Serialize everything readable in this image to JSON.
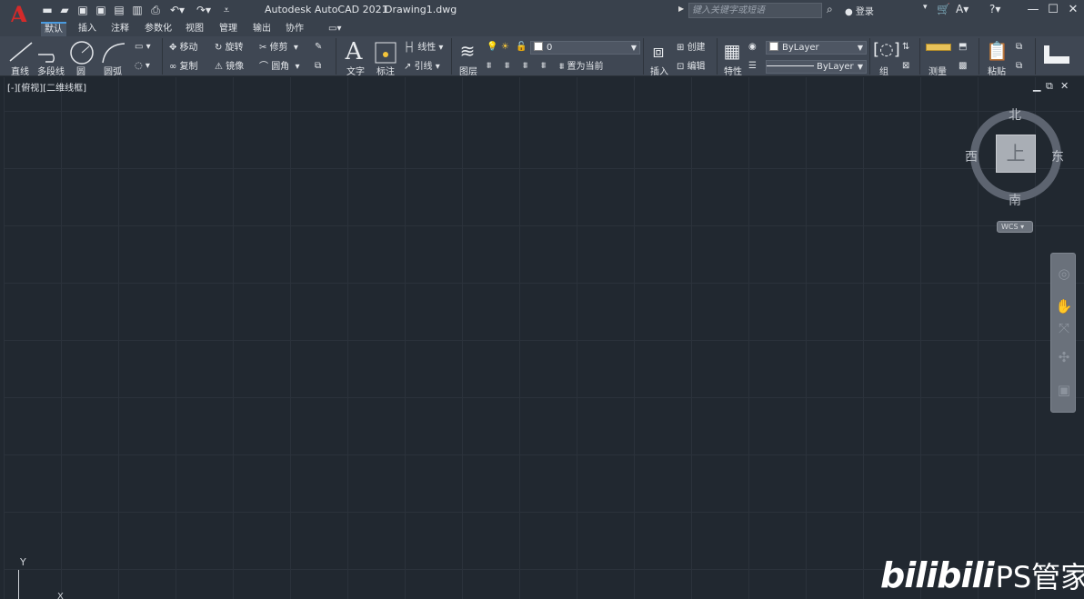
{
  "titlebar": {
    "logo": "A",
    "app_title": "Autodesk AutoCAD 2021",
    "doc_title": "Drawing1.dwg",
    "search_placeholder": "键入关键字或短语",
    "signin_label": "登录"
  },
  "tabs": [
    {
      "label": "默认",
      "active": true
    },
    {
      "label": "插入"
    },
    {
      "label": "注释"
    },
    {
      "label": "参数化"
    },
    {
      "label": "视图"
    },
    {
      "label": "管理"
    },
    {
      "label": "输出"
    },
    {
      "label": "协作"
    }
  ],
  "ribbon": {
    "draw": {
      "line": "直线",
      "polyline": "多段线",
      "circle": "圆",
      "arc": "圆弧"
    },
    "modify": {
      "move": "移动",
      "rotate": "旋转",
      "trim": "修剪",
      "copy": "复制",
      "mirror": "镜像",
      "fillet": "圆角"
    },
    "annotation": {
      "text": "文字",
      "dimension": "标注",
      "linear": "线性",
      "leader": "引线"
    },
    "layers": {
      "layer_props": "图层",
      "current_layer": "0",
      "make_current": "置为当前"
    },
    "block": {
      "insert": "插入",
      "create": "创建",
      "edit": "编辑"
    },
    "properties": {
      "match": "特性",
      "color": "ByLayer",
      "linetype": "ByLayer"
    },
    "groups": {
      "group": "组"
    },
    "utilities": {
      "measure": "测量"
    },
    "clipboard": {
      "paste": "粘贴"
    }
  },
  "viewport": {
    "label": "[-][俯视][二维线框]"
  },
  "viewcube": {
    "face": "上",
    "north": "北",
    "south": "南",
    "east": "东",
    "west": "西",
    "wcs": "WCS"
  },
  "ucs": {
    "y": "Y",
    "x": "X"
  },
  "watermark": {
    "brand": "bilibili",
    "text": "PS管家"
  },
  "colors": {
    "canvas": "#212830",
    "ribbon": "#3f4753",
    "accent": "#4a9be0",
    "logo": "#d42a2a"
  }
}
